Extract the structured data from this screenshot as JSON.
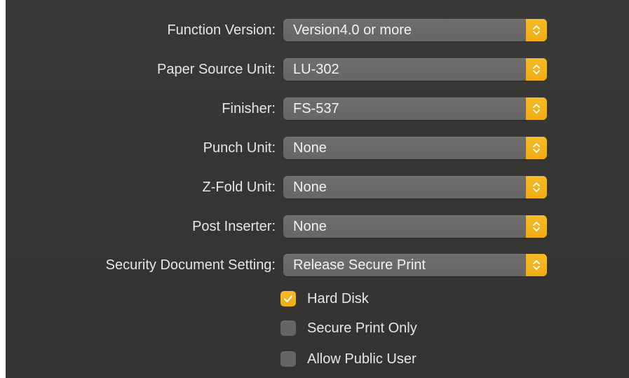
{
  "settings": {
    "rows": [
      {
        "label": "Function Version:",
        "value": "Version4.0 or more"
      },
      {
        "label": "Paper Source Unit:",
        "value": "LU-302"
      },
      {
        "label": "Finisher:",
        "value": "FS-537"
      },
      {
        "label": "Punch Unit:",
        "value": "None"
      },
      {
        "label": "Z-Fold Unit:",
        "value": "None"
      },
      {
        "label": "Post Inserter:",
        "value": "None"
      },
      {
        "label": "Security Document Setting:",
        "value": "Release Secure Print"
      }
    ],
    "checkboxes": [
      {
        "label": "Hard Disk",
        "checked": true
      },
      {
        "label": "Secure Print Only",
        "checked": false
      },
      {
        "label": "Allow Public User",
        "checked": false
      }
    ]
  },
  "colors": {
    "accent": "#f2b01e",
    "panel_background": "#383634",
    "popup_background": "#6b6a68",
    "text": "#e6e6e6"
  },
  "icons": {
    "popup_stepper": "chevron-up-down-icon",
    "checkmark": "checkmark-icon"
  }
}
